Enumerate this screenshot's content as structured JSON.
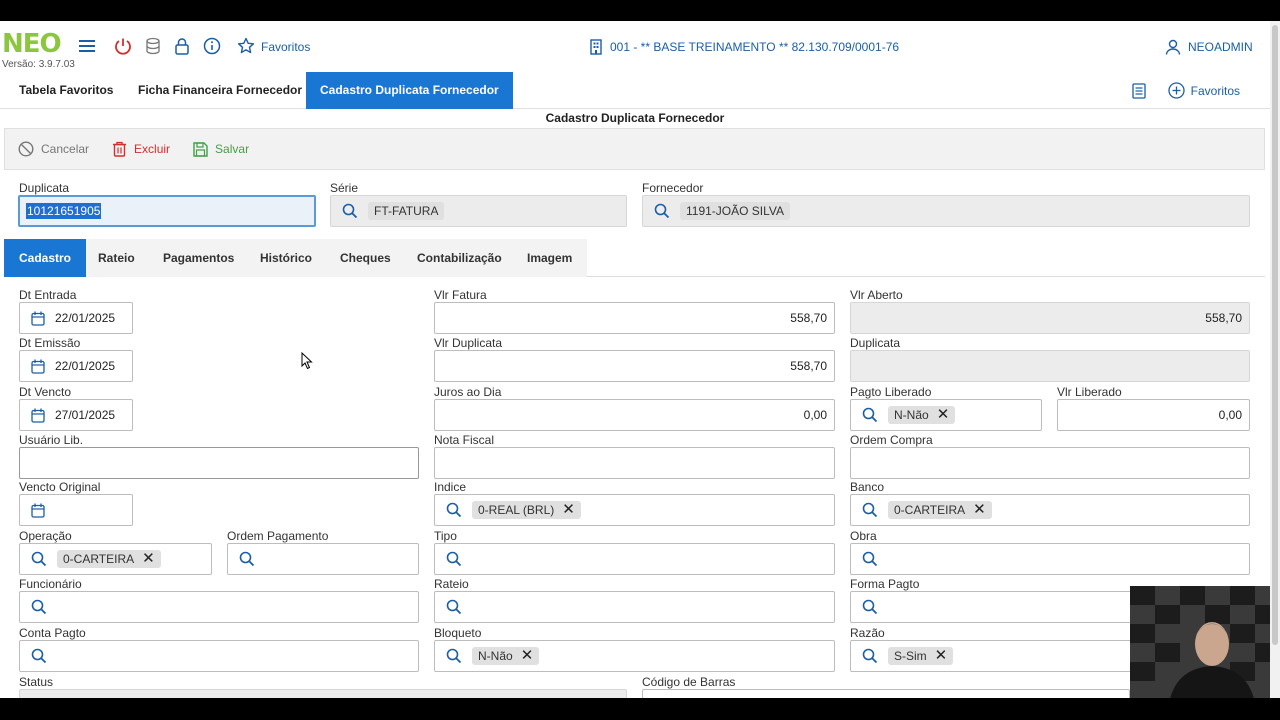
{
  "app": {
    "logo": "NEO",
    "version": "Versão: 3.9.7.03",
    "favorites": "Favoritos",
    "company": "001 - ** BASE TREINAMENTO ** 82.130.709/0001-76",
    "user": "NEOADMIN"
  },
  "tabs": [
    "Tabela Favoritos",
    "Ficha Financeira Fornecedor",
    "Cadastro Duplicata Fornecedor"
  ],
  "strip_favorites": "Favoritos",
  "page_title": "Cadastro Duplicata Fornecedor",
  "toolbar": {
    "cancel": "Cancelar",
    "delete": "Excluir",
    "save": "Salvar"
  },
  "header": {
    "duplicata_label": "Duplicata",
    "duplicata_value": "10121651905",
    "serie_label": "Série",
    "serie_value": "FT-FATURA",
    "fornecedor_label": "Fornecedor",
    "fornecedor_value": "1191-JOÃO SILVA"
  },
  "inner_tabs": [
    "Cadastro",
    "Rateio",
    "Pagamentos",
    "Histórico",
    "Cheques",
    "Contabilização",
    "Imagem"
  ],
  "form": {
    "dt_entrada_label": "Dt Entrada",
    "dt_entrada": "22/01/2025",
    "dt_emissao_label": "Dt Emissão",
    "dt_emissao": "22/01/2025",
    "dt_vencto_label": "Dt Vencto",
    "dt_vencto": "27/01/2025",
    "usuario_lib_label": "Usuário Lib.",
    "vencto_original_label": "Vencto Original",
    "operacao_label": "Operação",
    "operacao": "0-CARTEIRA",
    "ordem_pagamento_label": "Ordem Pagamento",
    "funcionario_label": "Funcionário",
    "conta_pagto_label": "Conta Pagto",
    "status_label": "Status",
    "vlr_fatura_label": "Vlr Fatura",
    "vlr_fatura": "558,70",
    "vlr_duplicata_label": "Vlr Duplicata",
    "vlr_duplicata": "558,70",
    "juros_label": "Juros ao Dia",
    "juros": "0,00",
    "nota_fiscal_label": "Nota Fiscal",
    "indice_label": "Indice",
    "indice": "0-REAL (BRL)",
    "tipo_label": "Tipo",
    "rateio_label": "Rateio",
    "bloqueto_label": "Bloqueto",
    "bloqueto": "N-Não",
    "codigo_barras_label": "Código de Barras",
    "vlr_aberto_label": "Vlr Aberto",
    "vlr_aberto": "558,70",
    "duplicata2_label": "Duplicata",
    "pagto_liberado_label": "Pagto Liberado",
    "pagto_liberado": "N-Não",
    "vlr_liberado_label": "Vlr Liberado",
    "vlr_liberado": "0,00",
    "ordem_compra_label": "Ordem Compra",
    "banco_label": "Banco",
    "banco": "0-CARTEIRA",
    "obra_label": "Obra",
    "forma_pagto_label": "Forma Pagto",
    "razao_label": "Razão",
    "razao": "S-Sim"
  },
  "colors": {
    "accent": "#1976d2",
    "logo": "#8cc63f",
    "link": "#1a5ea8",
    "danger": "#d32f2f",
    "success": "#43a047"
  }
}
